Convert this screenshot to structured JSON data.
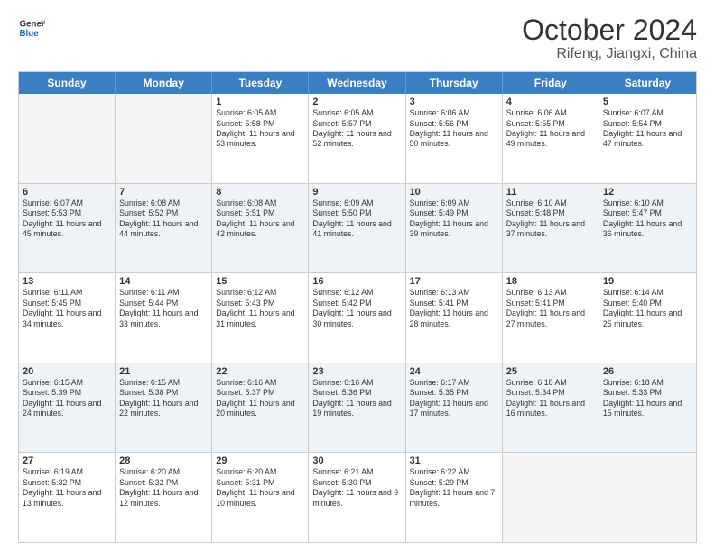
{
  "logo": {
    "line1": "General",
    "line2": "Blue"
  },
  "title": "October 2024",
  "location": "Rifeng, Jiangxi, China",
  "days_of_week": [
    "Sunday",
    "Monday",
    "Tuesday",
    "Wednesday",
    "Thursday",
    "Friday",
    "Saturday"
  ],
  "weeks": [
    [
      {
        "day": "",
        "sunrise": "",
        "sunset": "",
        "daylight": ""
      },
      {
        "day": "",
        "sunrise": "",
        "sunset": "",
        "daylight": ""
      },
      {
        "day": "1",
        "sunrise": "Sunrise: 6:05 AM",
        "sunset": "Sunset: 5:58 PM",
        "daylight": "Daylight: 11 hours and 53 minutes."
      },
      {
        "day": "2",
        "sunrise": "Sunrise: 6:05 AM",
        "sunset": "Sunset: 5:57 PM",
        "daylight": "Daylight: 11 hours and 52 minutes."
      },
      {
        "day": "3",
        "sunrise": "Sunrise: 6:06 AM",
        "sunset": "Sunset: 5:56 PM",
        "daylight": "Daylight: 11 hours and 50 minutes."
      },
      {
        "day": "4",
        "sunrise": "Sunrise: 6:06 AM",
        "sunset": "Sunset: 5:55 PM",
        "daylight": "Daylight: 11 hours and 49 minutes."
      },
      {
        "day": "5",
        "sunrise": "Sunrise: 6:07 AM",
        "sunset": "Sunset: 5:54 PM",
        "daylight": "Daylight: 11 hours and 47 minutes."
      }
    ],
    [
      {
        "day": "6",
        "sunrise": "Sunrise: 6:07 AM",
        "sunset": "Sunset: 5:53 PM",
        "daylight": "Daylight: 11 hours and 45 minutes."
      },
      {
        "day": "7",
        "sunrise": "Sunrise: 6:08 AM",
        "sunset": "Sunset: 5:52 PM",
        "daylight": "Daylight: 11 hours and 44 minutes."
      },
      {
        "day": "8",
        "sunrise": "Sunrise: 6:08 AM",
        "sunset": "Sunset: 5:51 PM",
        "daylight": "Daylight: 11 hours and 42 minutes."
      },
      {
        "day": "9",
        "sunrise": "Sunrise: 6:09 AM",
        "sunset": "Sunset: 5:50 PM",
        "daylight": "Daylight: 11 hours and 41 minutes."
      },
      {
        "day": "10",
        "sunrise": "Sunrise: 6:09 AM",
        "sunset": "Sunset: 5:49 PM",
        "daylight": "Daylight: 11 hours and 39 minutes."
      },
      {
        "day": "11",
        "sunrise": "Sunrise: 6:10 AM",
        "sunset": "Sunset: 5:48 PM",
        "daylight": "Daylight: 11 hours and 37 minutes."
      },
      {
        "day": "12",
        "sunrise": "Sunrise: 6:10 AM",
        "sunset": "Sunset: 5:47 PM",
        "daylight": "Daylight: 11 hours and 36 minutes."
      }
    ],
    [
      {
        "day": "13",
        "sunrise": "Sunrise: 6:11 AM",
        "sunset": "Sunset: 5:45 PM",
        "daylight": "Daylight: 11 hours and 34 minutes."
      },
      {
        "day": "14",
        "sunrise": "Sunrise: 6:11 AM",
        "sunset": "Sunset: 5:44 PM",
        "daylight": "Daylight: 11 hours and 33 minutes."
      },
      {
        "day": "15",
        "sunrise": "Sunrise: 6:12 AM",
        "sunset": "Sunset: 5:43 PM",
        "daylight": "Daylight: 11 hours and 31 minutes."
      },
      {
        "day": "16",
        "sunrise": "Sunrise: 6:12 AM",
        "sunset": "Sunset: 5:42 PM",
        "daylight": "Daylight: 11 hours and 30 minutes."
      },
      {
        "day": "17",
        "sunrise": "Sunrise: 6:13 AM",
        "sunset": "Sunset: 5:41 PM",
        "daylight": "Daylight: 11 hours and 28 minutes."
      },
      {
        "day": "18",
        "sunrise": "Sunrise: 6:13 AM",
        "sunset": "Sunset: 5:41 PM",
        "daylight": "Daylight: 11 hours and 27 minutes."
      },
      {
        "day": "19",
        "sunrise": "Sunrise: 6:14 AM",
        "sunset": "Sunset: 5:40 PM",
        "daylight": "Daylight: 11 hours and 25 minutes."
      }
    ],
    [
      {
        "day": "20",
        "sunrise": "Sunrise: 6:15 AM",
        "sunset": "Sunset: 5:39 PM",
        "daylight": "Daylight: 11 hours and 24 minutes."
      },
      {
        "day": "21",
        "sunrise": "Sunrise: 6:15 AM",
        "sunset": "Sunset: 5:38 PM",
        "daylight": "Daylight: 11 hours and 22 minutes."
      },
      {
        "day": "22",
        "sunrise": "Sunrise: 6:16 AM",
        "sunset": "Sunset: 5:37 PM",
        "daylight": "Daylight: 11 hours and 20 minutes."
      },
      {
        "day": "23",
        "sunrise": "Sunrise: 6:16 AM",
        "sunset": "Sunset: 5:36 PM",
        "daylight": "Daylight: 11 hours and 19 minutes."
      },
      {
        "day": "24",
        "sunrise": "Sunrise: 6:17 AM",
        "sunset": "Sunset: 5:35 PM",
        "daylight": "Daylight: 11 hours and 17 minutes."
      },
      {
        "day": "25",
        "sunrise": "Sunrise: 6:18 AM",
        "sunset": "Sunset: 5:34 PM",
        "daylight": "Daylight: 11 hours and 16 minutes."
      },
      {
        "day": "26",
        "sunrise": "Sunrise: 6:18 AM",
        "sunset": "Sunset: 5:33 PM",
        "daylight": "Daylight: 11 hours and 15 minutes."
      }
    ],
    [
      {
        "day": "27",
        "sunrise": "Sunrise: 6:19 AM",
        "sunset": "Sunset: 5:32 PM",
        "daylight": "Daylight: 11 hours and 13 minutes."
      },
      {
        "day": "28",
        "sunrise": "Sunrise: 6:20 AM",
        "sunset": "Sunset: 5:32 PM",
        "daylight": "Daylight: 11 hours and 12 minutes."
      },
      {
        "day": "29",
        "sunrise": "Sunrise: 6:20 AM",
        "sunset": "Sunset: 5:31 PM",
        "daylight": "Daylight: 11 hours and 10 minutes."
      },
      {
        "day": "30",
        "sunrise": "Sunrise: 6:21 AM",
        "sunset": "Sunset: 5:30 PM",
        "daylight": "Daylight: 11 hours and 9 minutes."
      },
      {
        "day": "31",
        "sunrise": "Sunrise: 6:22 AM",
        "sunset": "Sunset: 5:29 PM",
        "daylight": "Daylight: 11 hours and 7 minutes."
      },
      {
        "day": "",
        "sunrise": "",
        "sunset": "",
        "daylight": ""
      },
      {
        "day": "",
        "sunrise": "",
        "sunset": "",
        "daylight": ""
      }
    ]
  ]
}
